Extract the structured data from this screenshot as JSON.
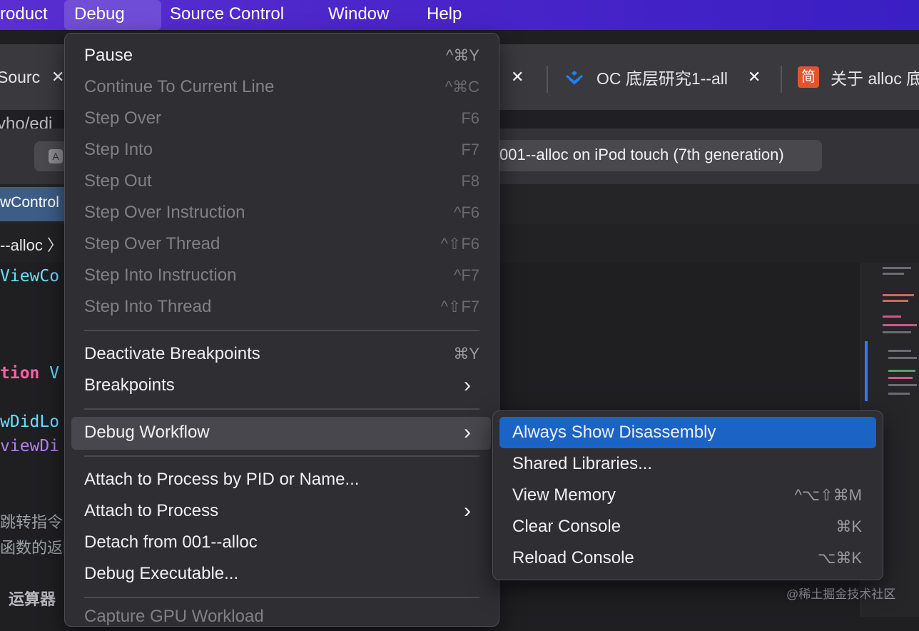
{
  "menubar": {
    "items": [
      "roduct",
      "Debug",
      "Source Control",
      "Window",
      "Help"
    ]
  },
  "browser_tabs": [
    {
      "title": "Sourc",
      "close": "✕"
    },
    {
      "title": "",
      "close": "✕"
    },
    {
      "title": "OC 底层研究1--all",
      "close": "✕"
    },
    {
      "title": "关于 alloc 底",
      "favicon": "简"
    }
  ],
  "address_fragment": "vho/edi",
  "scheme": "001--alloc on iPod touch (7th generation)",
  "editor_tab": "wControl",
  "jump_bar": "--alloc 〉",
  "code_fragments": {
    "line1": "ViewCo",
    "line2_kw": "tion",
    "line2_rest": " V",
    "line3": "wDidLo",
    "line4": "viewDi",
    "comment1": "跳转指令",
    "comment2": "函数的返回",
    "ops": "运算器"
  },
  "watermark": "@稀土掘金技术社区",
  "debug_menu": {
    "items": [
      {
        "label": "Pause",
        "shortcut": "^⌘Y",
        "enabled": true
      },
      {
        "label": "Continue To Current Line",
        "shortcut": "^⌘C",
        "enabled": false
      },
      {
        "label": "Step Over",
        "shortcut": "F6",
        "enabled": false
      },
      {
        "label": "Step Into",
        "shortcut": "F7",
        "enabled": false
      },
      {
        "label": "Step Out",
        "shortcut": "F8",
        "enabled": false
      },
      {
        "label": "Step Over Instruction",
        "shortcut": "^F6",
        "enabled": false
      },
      {
        "label": "Step Over Thread",
        "shortcut": "^⇧F6",
        "enabled": false
      },
      {
        "label": "Step Into Instruction",
        "shortcut": "^F7",
        "enabled": false
      },
      {
        "label": "Step Into Thread",
        "shortcut": "^⇧F7",
        "enabled": false
      },
      {
        "label": "Deactivate Breakpoints",
        "shortcut": "⌘Y",
        "enabled": true
      },
      {
        "label": "Breakpoints",
        "shortcut": "",
        "enabled": true,
        "submenu": true
      },
      {
        "label": "Debug Workflow",
        "shortcut": "",
        "enabled": true,
        "submenu": true,
        "highlighted": true
      },
      {
        "label": "Attach to Process by PID or Name...",
        "shortcut": "",
        "enabled": true
      },
      {
        "label": "Attach to Process",
        "shortcut": "",
        "enabled": true,
        "submenu": true
      },
      {
        "label": "Detach from 001--alloc",
        "shortcut": "",
        "enabled": true
      },
      {
        "label": "Debug Executable...",
        "shortcut": "",
        "enabled": true
      },
      {
        "label": "Capture GPU Workload",
        "shortcut": "",
        "enabled": false
      }
    ],
    "chevron": "›"
  },
  "workflow_submenu": {
    "items": [
      {
        "label": "Always Show Disassembly",
        "shortcut": "",
        "selected": true
      },
      {
        "label": "Shared Libraries...",
        "shortcut": ""
      },
      {
        "label": "View Memory",
        "shortcut": "^⌥⇧⌘M"
      },
      {
        "label": "Clear Console",
        "shortcut": "⌘K"
      },
      {
        "label": "Reload Console",
        "shortcut": "⌥⌘K"
      }
    ]
  },
  "colors": {
    "accent": "#1b63c4",
    "menubar": "#4a25c9",
    "menu_bg": "#2e2e33",
    "keyword": "#fc5fa3",
    "identifier": "#6bdfff"
  }
}
